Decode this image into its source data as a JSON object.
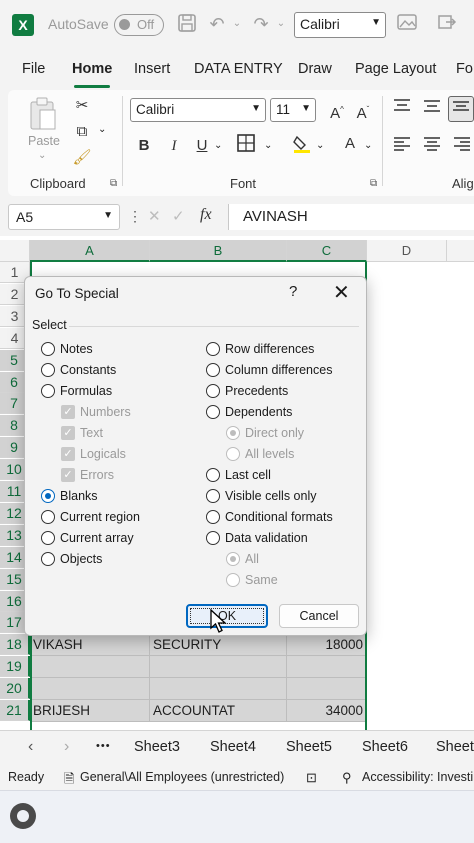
{
  "titlebar": {
    "app_logo": "X",
    "autosave_label": "AutoSave",
    "autosave_state": "Off",
    "font_value": "Calibri",
    "icons": [
      "save-icon",
      "undo-icon",
      "redo-icon",
      "picture-icon",
      "arrow-icon"
    ]
  },
  "ribbon_tabs": [
    "File",
    "Home",
    "Insert",
    "DATA ENTRY",
    "Draw",
    "Page Layout",
    "Fo"
  ],
  "ribbon": {
    "clipboard": {
      "paste_label": "Paste",
      "group_label": "Clipboard"
    },
    "font": {
      "font_name": "Calibri",
      "font_size": "11",
      "bold": "B",
      "italic": "I",
      "underline": "U",
      "group_label": "Font"
    },
    "alignment": {
      "group_label": "Alig"
    }
  },
  "formula_bar": {
    "name_box": "A5",
    "fx": "fx",
    "formula": "AVINASH"
  },
  "grid": {
    "columns": [
      "A",
      "B",
      "C",
      "D"
    ],
    "rows": [
      "1",
      "2",
      "3",
      "4",
      "5",
      "6",
      "7",
      "8",
      "9",
      "10",
      "11",
      "12",
      "13",
      "14",
      "15",
      "16",
      "17",
      "18",
      "19",
      "20",
      "21"
    ],
    "visible_rows": [
      {
        "row": "18",
        "a": "VIKASH",
        "b": "SECURITY",
        "c": "18000"
      },
      {
        "row": "19",
        "a": "",
        "b": "",
        "c": ""
      },
      {
        "row": "20",
        "a": "",
        "b": "",
        "c": ""
      },
      {
        "row": "21",
        "a": "BRIJESH",
        "b": "ACCOUNTAT",
        "c": "34000"
      }
    ]
  },
  "sheets": {
    "more": "•••",
    "tabs": [
      "Sheet3",
      "Sheet4",
      "Sheet5",
      "Sheet6",
      "Sheet"
    ]
  },
  "status": {
    "ready": "Ready",
    "classification": "General\\All Employees (unrestricted)",
    "accessibility": "Accessibility: Investi"
  },
  "dialog": {
    "title": "Go To Special",
    "help": "?",
    "close": "✕",
    "section": "Select",
    "left_options": [
      {
        "label": "Notes",
        "state": "off"
      },
      {
        "label": "Constants",
        "state": "off"
      },
      {
        "label": "Formulas",
        "state": "off"
      },
      {
        "label": "Numbers",
        "state": "checkbox-disabled"
      },
      {
        "label": "Text",
        "state": "checkbox-disabled"
      },
      {
        "label": "Logicals",
        "state": "checkbox-disabled"
      },
      {
        "label": "Errors",
        "state": "checkbox-disabled"
      },
      {
        "label": "Blanks",
        "state": "on"
      },
      {
        "label": "Current region",
        "state": "off"
      },
      {
        "label": "Current array",
        "state": "off"
      },
      {
        "label": "Objects",
        "state": "off"
      }
    ],
    "right_options": [
      {
        "label": "Row differences",
        "state": "off"
      },
      {
        "label": "Column differences",
        "state": "off"
      },
      {
        "label": "Precedents",
        "state": "off"
      },
      {
        "label": "Dependents",
        "state": "off"
      },
      {
        "label": "Direct only",
        "state": "disabled-on"
      },
      {
        "label": "All levels",
        "state": "disabled"
      },
      {
        "label": "Last cell",
        "state": "off"
      },
      {
        "label": "Visible cells only",
        "state": "off"
      },
      {
        "label": "Conditional formats",
        "state": "off"
      },
      {
        "label": "Data validation",
        "state": "off"
      },
      {
        "label": "All",
        "state": "disabled-on"
      },
      {
        "label": "Same",
        "state": "disabled"
      }
    ],
    "ok_label": "OK",
    "cancel_label": "Cancel"
  },
  "colors": {
    "excel_green": "#107c41",
    "accent_blue": "#0067c0",
    "selection_gray": "#d6d6d6"
  }
}
